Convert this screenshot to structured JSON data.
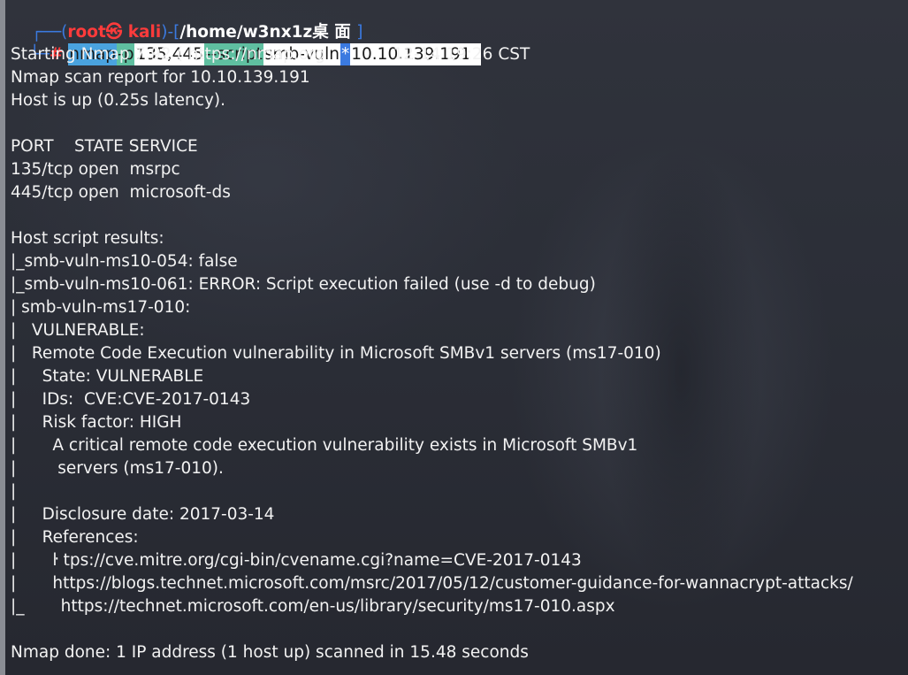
{
  "prompt": {
    "box_top": "┌──(",
    "user": "root㉿",
    "host": "kali",
    "sep": ")-[",
    "path": "/home/w3nx1z桌 面",
    "close": "]",
    "box_bottom": "└─",
    "hash": "#"
  },
  "command": {
    "cmd": "nmap",
    "flag_p": "-p",
    "ports": "135,445",
    "flag_script": "--script",
    "script": "smb-vuln",
    "star": "*",
    "target": "10.10.139.191"
  },
  "output": [
    "Starting Nmap 7.92 ( https://nmap.org             12-14 19:26 CST",
    "Nmap scan report for 10.10.139.191",
    "Host is up (0.25s latency).",
    "",
    "PORT    STATE SERVICE",
    "135/tcp open  msrpc",
    "445/tcp open  microsoft-ds",
    "",
    "Host script results:",
    "|_smb-vuln-ms10-054: false",
    "|_smb-vuln-ms10-061: ERROR: Script execution failed (use -d to debug)",
    "| smb-vuln-ms17-010:",
    "|   VULNERABLE:",
    "|   Remote Code Execution vulnerability in Microsoft SMBv1 servers (ms17-010)",
    "|     State: VULNERABLE",
    "|     IDs:  CVE:CVE-2017-0143",
    "|     Risk factor: HIGH",
    "|       A critical remote code execution vulnerability exists in Microsoft SMBv1",
    "|        servers (ms17-010).",
    "|",
    "|     Disclosure date: 2017-03-14",
    "|     References:",
    "|       ŀ tps://cve.mitre.org/cgi-bin/cvename.cgi?name=CVE-2017-0143",
    "|       https://blogs.technet.microsoft.com/msrc/2017/05/12/customer-guidance-for-wannacrypt-attacks/",
    "|_       https://technet.microsoft.com/en-us/library/security/ms17-010.aspx",
    "",
    "Nmap done: 1 IP address (1 host up) scanned in 15.48 seconds"
  ]
}
